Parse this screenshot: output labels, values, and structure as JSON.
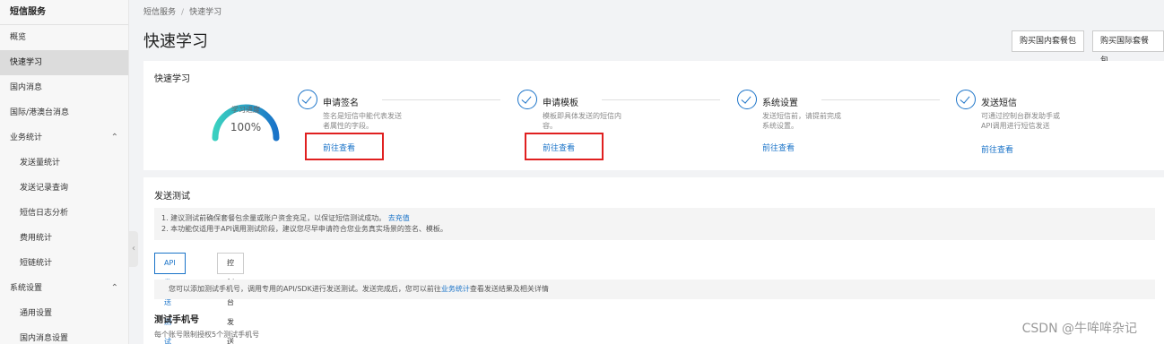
{
  "sidebar": {
    "title": "短信服务",
    "items": [
      {
        "label": "概览"
      },
      {
        "label": "快速学习"
      },
      {
        "label": "国内消息"
      },
      {
        "label": "国际/港澳台消息"
      },
      {
        "label": "业务统计"
      },
      {
        "label": "发送量统计"
      },
      {
        "label": "发送记录查询"
      },
      {
        "label": "短信日志分析"
      },
      {
        "label": "费用统计"
      },
      {
        "label": "短链统计"
      },
      {
        "label": "系统设置"
      },
      {
        "label": "通用设置"
      },
      {
        "label": "国内消息设置"
      }
    ],
    "chevron": "⌃",
    "handle": "‹"
  },
  "breadcrumb": {
    "root": "短信服务",
    "sep": "/",
    "current": "快速学习"
  },
  "page_title": "快速学习",
  "top_buttons": {
    "domestic": "购买国内套餐包",
    "international": "购买国际套餐包"
  },
  "quick": {
    "title": "快速学习",
    "progress_label": "学习进度",
    "progress_value": "100%",
    "progress_fraction": 1.0,
    "steps": [
      {
        "title": "申请签名",
        "desc": "签名是短信中能代表发送者属性的字段。",
        "link": "前往查看"
      },
      {
        "title": "申请模板",
        "desc": "模板即具体发送的短信内容。",
        "link": "前往查看"
      },
      {
        "title": "系统设置",
        "desc": "发送短信前，请提前完成系统设置。",
        "link": "前往查看"
      },
      {
        "title": "发送短信",
        "desc": "可通过控制台群发助手或API调用进行短信发送",
        "link": "前往查看"
      }
    ]
  },
  "send_test": {
    "title": "发送测试",
    "notice1": "1. 建议测试前确保套餐包余量或账户资金充足，以保证短信测试成功。",
    "notice1_link": "去充值",
    "notice2": "2. 本功能仅适用于API调用测试阶段，建议您尽早申请符合您业务真实场景的签名、模板。",
    "tab_api": "API发送测试",
    "tab_console": "控制台发送测试",
    "info_prefix": "您可以添加测试手机号，调用专用的API/SDK进行发送测试。发送完成后，您可以前往",
    "info_link": "业务统计",
    "info_suffix": "查看发送结果及相关详情",
    "phone_title": "测试手机号",
    "phone_sub": "每个账号限制授权5个测试手机号"
  },
  "watermark": "CSDN @牛哞哞杂记",
  "colors": {
    "accent": "#1a73c8",
    "highlight_box": "#e02020",
    "gauge_start": "#3ad0c0",
    "gauge_end": "#1a73c8"
  }
}
